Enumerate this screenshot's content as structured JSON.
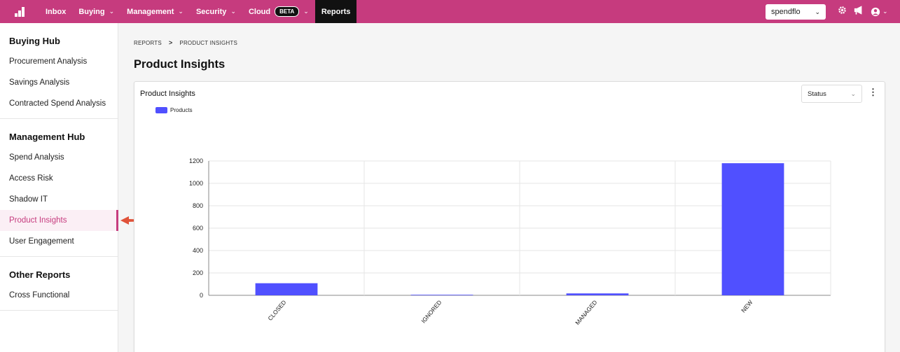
{
  "topnav": {
    "items": [
      {
        "label": "Inbox",
        "dropdown": false
      },
      {
        "label": "Buying",
        "dropdown": true
      },
      {
        "label": "Management",
        "dropdown": true
      },
      {
        "label": "Security",
        "dropdown": true
      },
      {
        "label": "Cloud",
        "dropdown": true,
        "badge": "BETA"
      },
      {
        "label": "Reports",
        "dropdown": false,
        "active": true
      }
    ],
    "org_select": "spendflo",
    "icons": [
      "gear-icon",
      "megaphone-icon",
      "user-account-icon"
    ],
    "brand_color": "#c63b7e"
  },
  "sidebar": {
    "sections": [
      {
        "heading": "Buying Hub",
        "items": [
          "Procurement Analysis",
          "Savings Analysis",
          "Contracted Spend Analysis"
        ]
      },
      {
        "heading": "Management Hub",
        "items": [
          "Spend Analysis",
          "Access Risk",
          "Shadow IT",
          "Product Insights",
          "User Engagement"
        ]
      },
      {
        "heading": "Other Reports",
        "items": [
          "Cross Functional"
        ]
      }
    ],
    "active_item": "Product Insights"
  },
  "breadcrumb": {
    "items": [
      "REPORTS",
      "PRODUCT INSIGHTS"
    ],
    "separator": ">"
  },
  "page_title": "Product Insights",
  "card": {
    "title": "Product Insights",
    "status_select": "Status",
    "menu_icon": "kebab-icon"
  },
  "chart_data": {
    "type": "bar",
    "categories": [
      "CLOSED",
      "IGNORED",
      "MANAGED",
      "NEW"
    ],
    "series": [
      {
        "name": "Products",
        "values": [
          108,
          5,
          17,
          1180
        ],
        "color": "#5050ff"
      }
    ],
    "title": "",
    "xlabel": "",
    "ylabel": "",
    "ylim": [
      0,
      1200
    ],
    "yticks": [
      0,
      200,
      400,
      600,
      800,
      1000,
      1200
    ],
    "grid": true,
    "legend_position": "top-left"
  }
}
